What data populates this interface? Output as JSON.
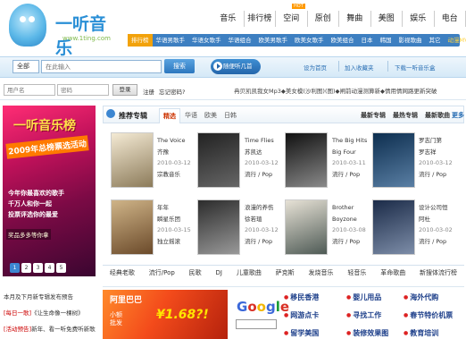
{
  "logo": {
    "name": "一听音乐",
    "url": "www.1ting.com"
  },
  "topnav": {
    "items": [
      "音乐",
      "排行榜",
      "空间",
      "原创",
      "舞曲",
      "美图",
      "娱乐",
      "电台"
    ],
    "hot_badge": "HOT"
  },
  "subnav": {
    "items": [
      "排行榜",
      "华语男歌手",
      "华语女歌手",
      "华语组合",
      "欧美男歌手",
      "欧美女歌手",
      "欧美组合",
      "日本",
      "韩国",
      "影视歌曲",
      "其它",
      "动漫MV"
    ]
  },
  "search": {
    "category": "全部",
    "placeholder": "在此输入",
    "button": "搜索",
    "listen": "随便听几首"
  },
  "tools": {
    "home": "设为首页",
    "favorite": "加入收藏夹",
    "download": "下载一听音乐盒"
  },
  "login": {
    "user_placeholder": "用户名",
    "pw_placeholder": "密码",
    "login_btn": "登录",
    "register": "注册",
    "forgot": "忘记密码?"
  },
  "marquee": "冉贝凯凯我女Mp3◆美女模(沙利图)(图)◆闸前动漫测算新◆情用情网路更新突破",
  "banner": {
    "title": "一听音乐榜",
    "subtitle": "2009年总榜票选活动",
    "body1": "今年你最喜欢的歌手",
    "body2": "千万人和你一起",
    "body3": "投票评选你的最爱",
    "prize": "奖品多多等你拿",
    "dots": [
      "1",
      "2",
      "3",
      "4",
      "5"
    ]
  },
  "notices": [
    {
      "text": "本月及下月新专辑发布预告",
      "tag": ""
    },
    {
      "tag": "[每日一歌]",
      "text": "《让生命像一棵树》"
    },
    {
      "tag": "[活动预告]",
      "text": "新年、看一听免费听新歌"
    }
  ],
  "panel": {
    "title": "推荐专辑",
    "tabs": [
      "精选",
      "华语",
      "欧美",
      "日韩"
    ],
    "right_tabs": [
      "最新专辑",
      "最热专辑",
      "最新歌曲",
      "更多"
    ]
  },
  "albums": [
    {
      "title": "The Voice",
      "artist": "齐豫",
      "date": "2010-03-12",
      "genre": "宗教音乐",
      "c1": "#f4ead4",
      "c2": "#8c7b5a"
    },
    {
      "title": "Time Flies",
      "artist": "苏凯达",
      "date": "2010-03-12",
      "genre": "流行 / Pop",
      "c1": "#222",
      "c2": "#666"
    },
    {
      "title": "The Big Hits",
      "artist": "Big Four",
      "date": "2010-03-11",
      "genre": "流行 / Pop",
      "c1": "#111",
      "c2": "#8a8a8a"
    },
    {
      "title": "罗志门第",
      "artist": "罗志祥",
      "date": "2010-03-12",
      "genre": "流行 / Pop",
      "c1": "#0d2e4f",
      "c2": "#5a7fa4"
    },
    {
      "title": "年年",
      "artist": "瞬星乐团",
      "date": "2010-03-15",
      "genre": "独立摇滚",
      "c1": "#cfb488",
      "c2": "#6b4a2a"
    },
    {
      "title": "浪漫的养伤",
      "artist": "徐若瑄",
      "date": "2010-03-12",
      "genre": "流行 / Pop",
      "c1": "#2c2c2c",
      "c2": "#999"
    },
    {
      "title": "Brother",
      "artist": "Boyzone",
      "date": "2010-03-08",
      "genre": "流行 / Pop",
      "c1": "#e7e2d6",
      "c2": "#4e5a55"
    },
    {
      "title": "设计公司恒",
      "artist": "阿杜",
      "date": "2010-03-02",
      "genre": "流行 / Pop",
      "c1": "#1b2b48",
      "c2": "#7d8da8"
    }
  ],
  "genres": [
    "经典老歌",
    "流行/Pop",
    "民歌",
    "DJ",
    "儿童歌曲",
    "萨克斯",
    "发烧音乐",
    "轻音乐",
    "革命歌曲",
    "新搜体流行榜"
  ],
  "ad": {
    "title": "阿里巴巴",
    "price": "¥1.68?!",
    "line1": "小额",
    "line2": "批发"
  },
  "google": {
    "letters": [
      "G",
      "o",
      "o",
      "g",
      "l",
      "e"
    ]
  },
  "bottom_links": [
    "移民香港",
    "婴儿用品",
    "海外代购",
    "网游点卡",
    "寻找工作",
    "春节特价机票",
    "留学美国",
    "装修效果图",
    "教育培训"
  ]
}
